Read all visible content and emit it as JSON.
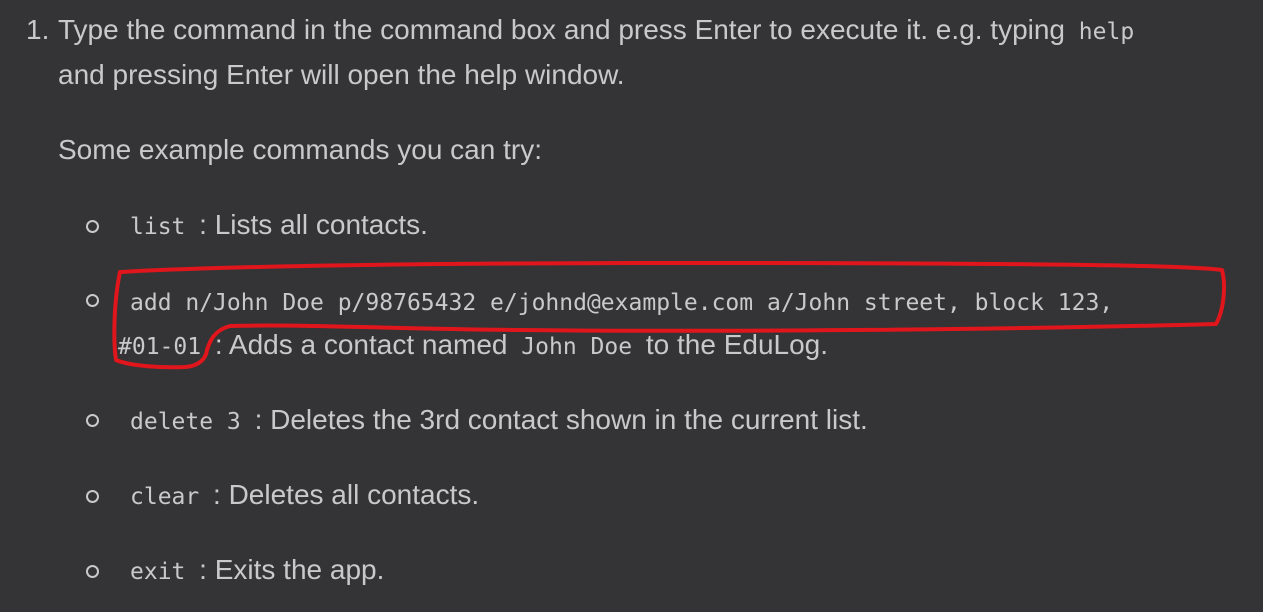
{
  "step": {
    "number": "1.",
    "text_before": "Type the command in the command box and press Enter to execute it. e.g. typing",
    "code": "help",
    "text_after": "and pressing Enter will open the help window."
  },
  "examples_intro": "Some example commands you can try:",
  "examples": [
    {
      "code": "list",
      "desc": ": Lists all contacts."
    },
    {
      "code_line1": "add n/John Doe p/98765432 e/johnd@example.com a/John street, block 123,",
      "code_line2": "#01-01",
      "desc_before": ": Adds a contact named",
      "name_code": "John Doe",
      "desc_after": "to the EduLog."
    },
    {
      "code": "delete 3",
      "desc": ": Deletes the 3rd contact shown in the current list."
    },
    {
      "code": "clear",
      "desc": ": Deletes all contacts."
    },
    {
      "code": "exit",
      "desc": ": Exits the app."
    }
  ],
  "colors": {
    "background": "#343436",
    "text": "#c9c9cb",
    "annotation": "#e0161c"
  }
}
